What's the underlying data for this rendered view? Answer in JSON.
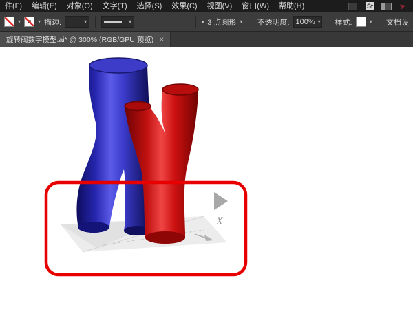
{
  "menu_bar": {
    "items": [
      "件(F)",
      "编辑(E)",
      "对象(O)",
      "文字(T)",
      "选择(S)",
      "效果(C)",
      "视图(V)",
      "窗口(W)",
      "帮助(H)"
    ],
    "st_badge": "St"
  },
  "control_bar": {
    "stroke_label": "描边:",
    "brush_bullet": "•",
    "brush_name": "3 点圆形",
    "opacity_label": "不透明度:",
    "opacity_value": "100%",
    "style_label": "样式:",
    "doc_setup_label": "文档设"
  },
  "tab_bar": {
    "title": "旋转阀数字模型.ai* @ 300% (RGB/GPU 预览)",
    "close": "×"
  },
  "canvas": {
    "axis_x_label": "X"
  },
  "colors": {
    "tube_blue": "#2b2bb4",
    "tube_blue_dark": "#10105e",
    "tube_red": "#c01212",
    "tube_red_dark": "#8f0606",
    "annotation_red": "#e80000",
    "triangle_gray": "#a8a8a8",
    "plane_gray": "#ececec",
    "menu_bg": "#1c1c1c",
    "control_bg": "#3c3c3c",
    "tab_bg": "#4d4d4d"
  }
}
